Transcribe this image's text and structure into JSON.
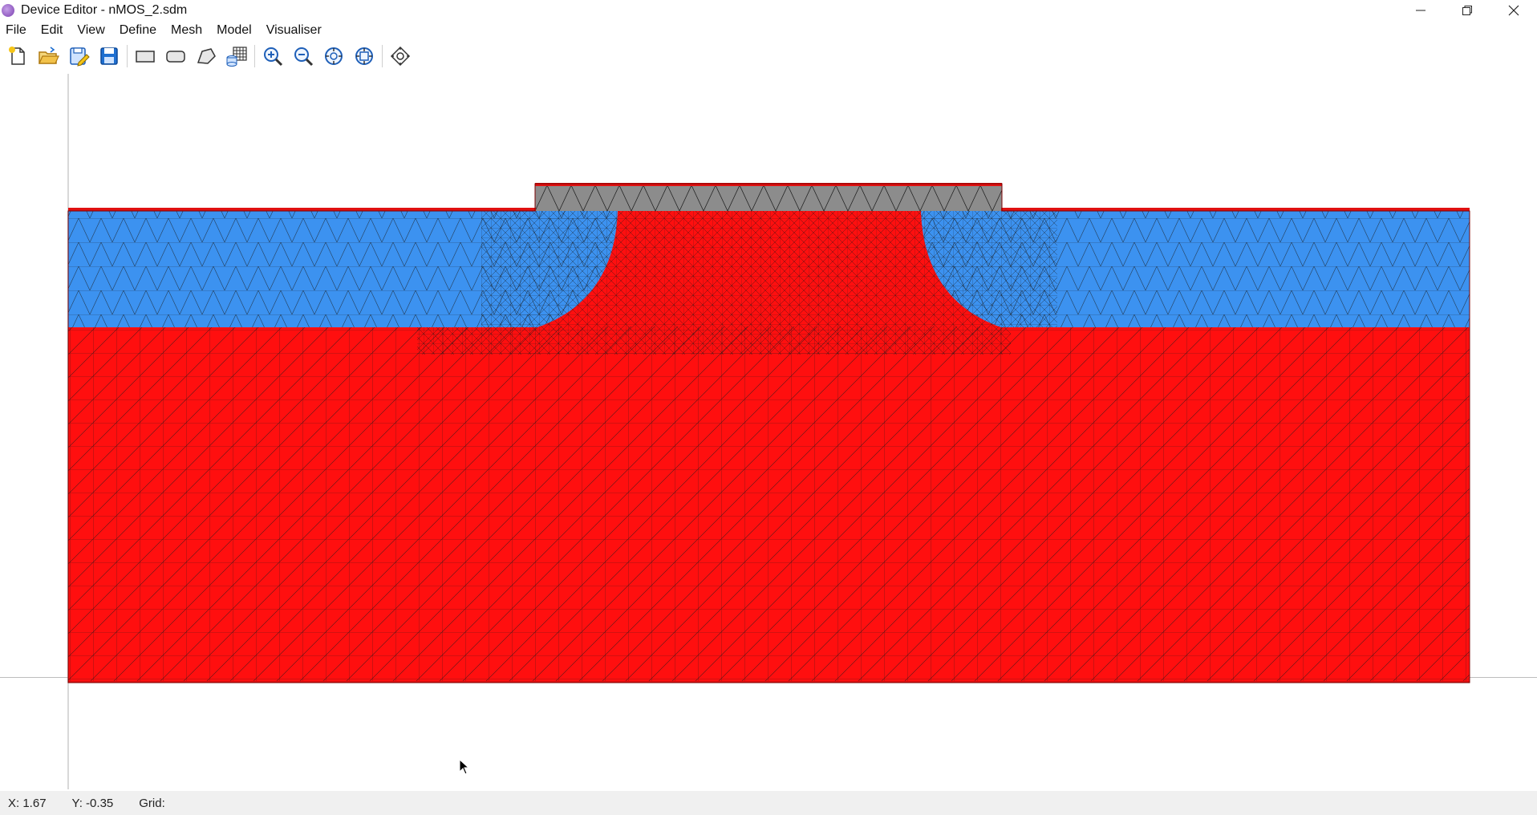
{
  "window": {
    "title": "Device Editor - nMOS_2.sdm",
    "controls": [
      "minimize-icon",
      "restore-icon",
      "close-icon"
    ]
  },
  "menu": [
    "File",
    "Edit",
    "View",
    "Define",
    "Mesh",
    "Model",
    "Visualiser"
  ],
  "toolbar": {
    "groups": [
      [
        "new-file-icon",
        "open-folder-icon",
        "save-as-icon",
        "save-icon"
      ],
      [
        "rectangle-icon",
        "rounded-rectangle-icon",
        "polygon-icon",
        "mesh-grid-icon"
      ],
      [
        "zoom-in-icon",
        "zoom-out-icon",
        "zoom-fit-icon",
        "zoom-all-icon"
      ],
      [
        "pan-icon"
      ]
    ]
  },
  "colors": {
    "substrate": "#ff0f0f",
    "source_drain": "#3c92f0",
    "gate_oxide": "#8c8c8c",
    "contact": "#e01010",
    "mesh_line": "#1a1a1a"
  },
  "status": {
    "x": "X: 1.67",
    "y": "Y: -0.35",
    "grid": "Grid:"
  }
}
